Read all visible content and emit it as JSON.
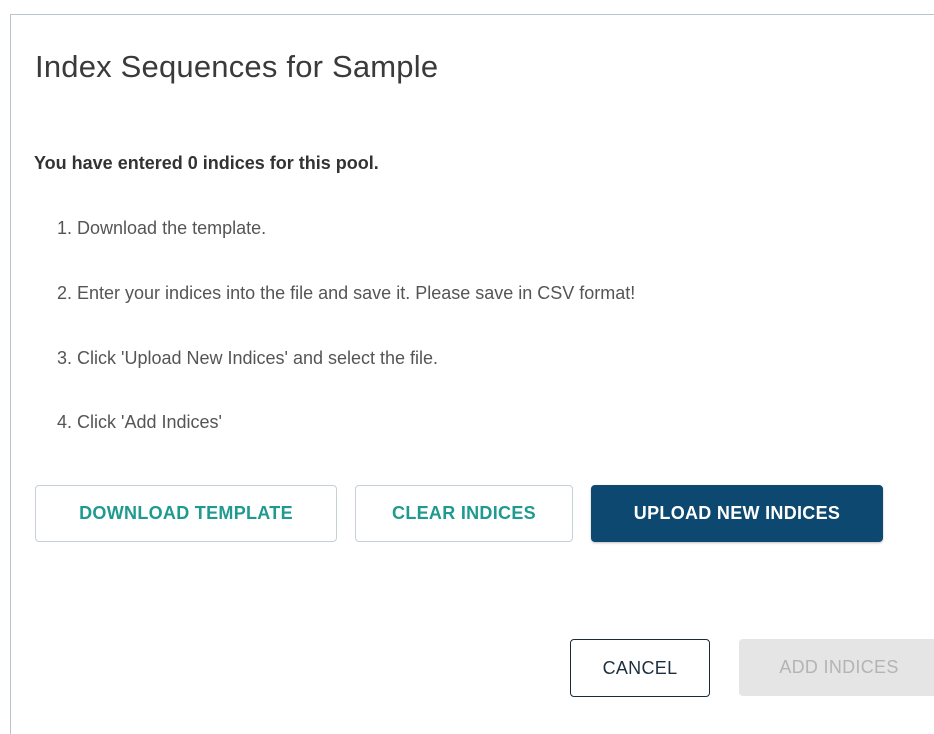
{
  "dialog": {
    "title": "Index Sequences for Sample",
    "summary": "You have entered 0 indices for this pool.",
    "steps": [
      "1. Download the template.",
      "2. Enter your indices into the file and save it. Please save in CSV format!",
      "3. Click 'Upload New Indices' and select the file.",
      "4. Click 'Add Indices'"
    ]
  },
  "actions": {
    "download_template": "DOWNLOAD TEMPLATE",
    "clear_indices": "CLEAR INDICES",
    "upload_new_indices": "UPLOAD NEW INDICES"
  },
  "footer": {
    "cancel": "CANCEL",
    "add_indices": "ADD INDICES",
    "add_indices_disabled": true
  },
  "colors": {
    "primary": "#0d4870",
    "outline_text": "#1f9a90",
    "disabled_bg": "#e5e5e5",
    "disabled_text": "#b4b4b4"
  }
}
